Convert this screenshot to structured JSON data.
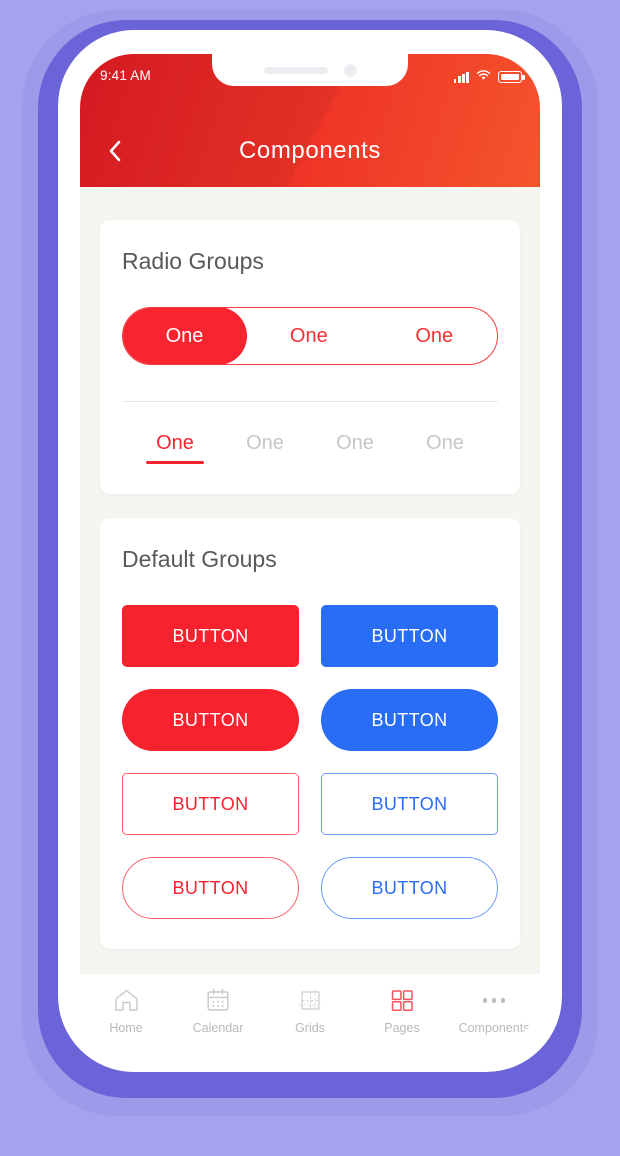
{
  "status_bar": {
    "time": "9:41 AM",
    "signal_icon": "signal-bars-icon",
    "wifi_icon": "wifi-icon",
    "battery_icon": "battery-icon"
  },
  "header": {
    "title": "Components",
    "back_icon": "chevron-left-icon"
  },
  "cards": [
    {
      "title": "Radio Groups",
      "segmented": {
        "options": [
          {
            "label": "One",
            "selected": true
          },
          {
            "label": "One",
            "selected": false
          },
          {
            "label": "One",
            "selected": false
          }
        ]
      },
      "tabs": {
        "options": [
          {
            "label": "One",
            "selected": true
          },
          {
            "label": "One",
            "selected": false
          },
          {
            "label": "One",
            "selected": false
          },
          {
            "label": "One",
            "selected": false
          }
        ]
      }
    },
    {
      "title": "Default Groups",
      "buttons": [
        {
          "label": "BUTTON",
          "style": "solid-red"
        },
        {
          "label": "BUTTON",
          "style": "solid-blue"
        },
        {
          "label": "BUTTON",
          "style": "pill-red"
        },
        {
          "label": "BUTTON",
          "style": "pill-blue"
        },
        {
          "label": "BUTTON",
          "style": "out-red"
        },
        {
          "label": "BUTTON",
          "style": "out-blue"
        },
        {
          "label": "BUTTON",
          "style": "outpill-red"
        },
        {
          "label": "BUTTON",
          "style": "outpill-blue"
        }
      ]
    }
  ],
  "tabbar": {
    "items": [
      {
        "label": "Home",
        "icon": "home-icon",
        "active": false
      },
      {
        "label": "Calendar",
        "icon": "calendar-icon",
        "active": false
      },
      {
        "label": "Grids",
        "icon": "grid-icon",
        "active": false
      },
      {
        "label": "Pages",
        "icon": "pages-icon",
        "active": true
      },
      {
        "label": "Components",
        "icon": "ellipsis-icon",
        "active": false
      }
    ]
  },
  "colors": {
    "accent_red": "#f82430",
    "accent_blue": "#2a6df5",
    "header_gradient_start": "#e01b24",
    "header_gradient_end": "#f4552c",
    "page_background": "#f7f5f0",
    "frame_purple": "#6b63d8",
    "backdrop_purple": "#a5a2ee"
  }
}
